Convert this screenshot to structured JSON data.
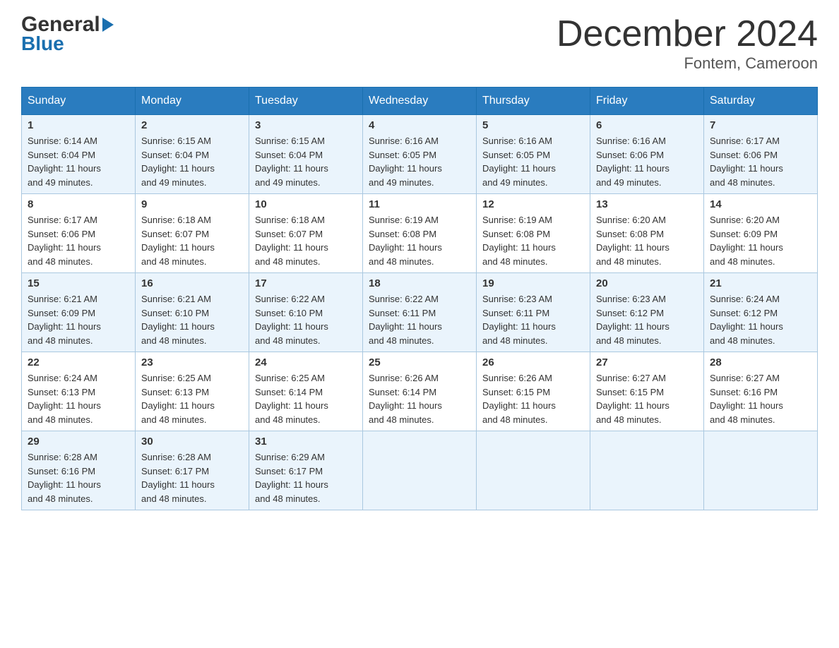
{
  "logo": {
    "general": "General",
    "arrow": "▶",
    "blue": "Blue"
  },
  "header": {
    "title": "December 2024",
    "location": "Fontem, Cameroon"
  },
  "days_of_week": [
    "Sunday",
    "Monday",
    "Tuesday",
    "Wednesday",
    "Thursday",
    "Friday",
    "Saturday"
  ],
  "weeks": [
    [
      {
        "day": "1",
        "sunrise": "6:14 AM",
        "sunset": "6:04 PM",
        "daylight": "11 hours and 49 minutes."
      },
      {
        "day": "2",
        "sunrise": "6:15 AM",
        "sunset": "6:04 PM",
        "daylight": "11 hours and 49 minutes."
      },
      {
        "day": "3",
        "sunrise": "6:15 AM",
        "sunset": "6:04 PM",
        "daylight": "11 hours and 49 minutes."
      },
      {
        "day": "4",
        "sunrise": "6:16 AM",
        "sunset": "6:05 PM",
        "daylight": "11 hours and 49 minutes."
      },
      {
        "day": "5",
        "sunrise": "6:16 AM",
        "sunset": "6:05 PM",
        "daylight": "11 hours and 49 minutes."
      },
      {
        "day": "6",
        "sunrise": "6:16 AM",
        "sunset": "6:06 PM",
        "daylight": "11 hours and 49 minutes."
      },
      {
        "day": "7",
        "sunrise": "6:17 AM",
        "sunset": "6:06 PM",
        "daylight": "11 hours and 48 minutes."
      }
    ],
    [
      {
        "day": "8",
        "sunrise": "6:17 AM",
        "sunset": "6:06 PM",
        "daylight": "11 hours and 48 minutes."
      },
      {
        "day": "9",
        "sunrise": "6:18 AM",
        "sunset": "6:07 PM",
        "daylight": "11 hours and 48 minutes."
      },
      {
        "day": "10",
        "sunrise": "6:18 AM",
        "sunset": "6:07 PM",
        "daylight": "11 hours and 48 minutes."
      },
      {
        "day": "11",
        "sunrise": "6:19 AM",
        "sunset": "6:08 PM",
        "daylight": "11 hours and 48 minutes."
      },
      {
        "day": "12",
        "sunrise": "6:19 AM",
        "sunset": "6:08 PM",
        "daylight": "11 hours and 48 minutes."
      },
      {
        "day": "13",
        "sunrise": "6:20 AM",
        "sunset": "6:08 PM",
        "daylight": "11 hours and 48 minutes."
      },
      {
        "day": "14",
        "sunrise": "6:20 AM",
        "sunset": "6:09 PM",
        "daylight": "11 hours and 48 minutes."
      }
    ],
    [
      {
        "day": "15",
        "sunrise": "6:21 AM",
        "sunset": "6:09 PM",
        "daylight": "11 hours and 48 minutes."
      },
      {
        "day": "16",
        "sunrise": "6:21 AM",
        "sunset": "6:10 PM",
        "daylight": "11 hours and 48 minutes."
      },
      {
        "day": "17",
        "sunrise": "6:22 AM",
        "sunset": "6:10 PM",
        "daylight": "11 hours and 48 minutes."
      },
      {
        "day": "18",
        "sunrise": "6:22 AM",
        "sunset": "6:11 PM",
        "daylight": "11 hours and 48 minutes."
      },
      {
        "day": "19",
        "sunrise": "6:23 AM",
        "sunset": "6:11 PM",
        "daylight": "11 hours and 48 minutes."
      },
      {
        "day": "20",
        "sunrise": "6:23 AM",
        "sunset": "6:12 PM",
        "daylight": "11 hours and 48 minutes."
      },
      {
        "day": "21",
        "sunrise": "6:24 AM",
        "sunset": "6:12 PM",
        "daylight": "11 hours and 48 minutes."
      }
    ],
    [
      {
        "day": "22",
        "sunrise": "6:24 AM",
        "sunset": "6:13 PM",
        "daylight": "11 hours and 48 minutes."
      },
      {
        "day": "23",
        "sunrise": "6:25 AM",
        "sunset": "6:13 PM",
        "daylight": "11 hours and 48 minutes."
      },
      {
        "day": "24",
        "sunrise": "6:25 AM",
        "sunset": "6:14 PM",
        "daylight": "11 hours and 48 minutes."
      },
      {
        "day": "25",
        "sunrise": "6:26 AM",
        "sunset": "6:14 PM",
        "daylight": "11 hours and 48 minutes."
      },
      {
        "day": "26",
        "sunrise": "6:26 AM",
        "sunset": "6:15 PM",
        "daylight": "11 hours and 48 minutes."
      },
      {
        "day": "27",
        "sunrise": "6:27 AM",
        "sunset": "6:15 PM",
        "daylight": "11 hours and 48 minutes."
      },
      {
        "day": "28",
        "sunrise": "6:27 AM",
        "sunset": "6:16 PM",
        "daylight": "11 hours and 48 minutes."
      }
    ],
    [
      {
        "day": "29",
        "sunrise": "6:28 AM",
        "sunset": "6:16 PM",
        "daylight": "11 hours and 48 minutes."
      },
      {
        "day": "30",
        "sunrise": "6:28 AM",
        "sunset": "6:17 PM",
        "daylight": "11 hours and 48 minutes."
      },
      {
        "day": "31",
        "sunrise": "6:29 AM",
        "sunset": "6:17 PM",
        "daylight": "11 hours and 48 minutes."
      },
      null,
      null,
      null,
      null
    ]
  ],
  "labels": {
    "sunrise": "Sunrise:",
    "sunset": "Sunset:",
    "daylight": "Daylight:"
  }
}
